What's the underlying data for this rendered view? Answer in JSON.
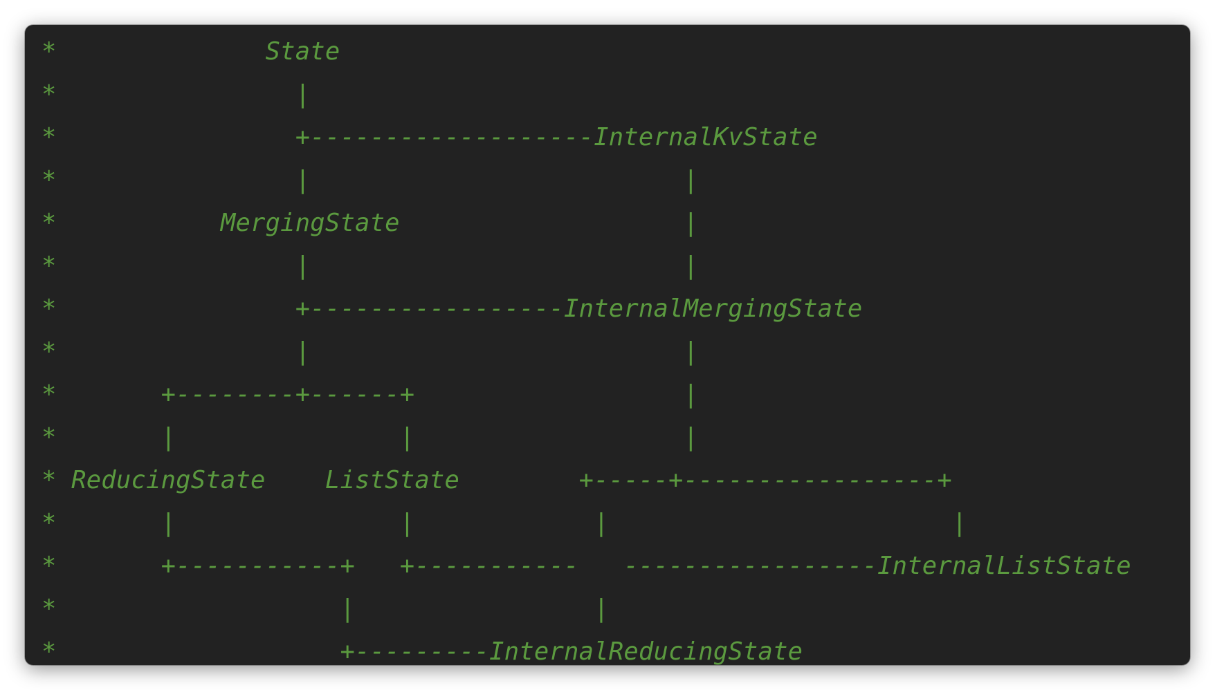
{
  "editor": {
    "lines": [
      "*              State",
      "*                |",
      "*                +-------------------InternalKvState",
      "*                |                         |",
      "*           MergingState                   |",
      "*                |                         |",
      "*                +-----------------InternalMergingState",
      "*                |                         |",
      "*       +--------+------+                  |",
      "*       |               |                  |",
      "* ReducingState    ListState        +-----+-----------------+",
      "*       |               |            |                       |",
      "*       +-----------+   +-----------   -----------------InternalListState",
      "*                   |                |",
      "*                   +---------InternalReducingState"
    ]
  }
}
